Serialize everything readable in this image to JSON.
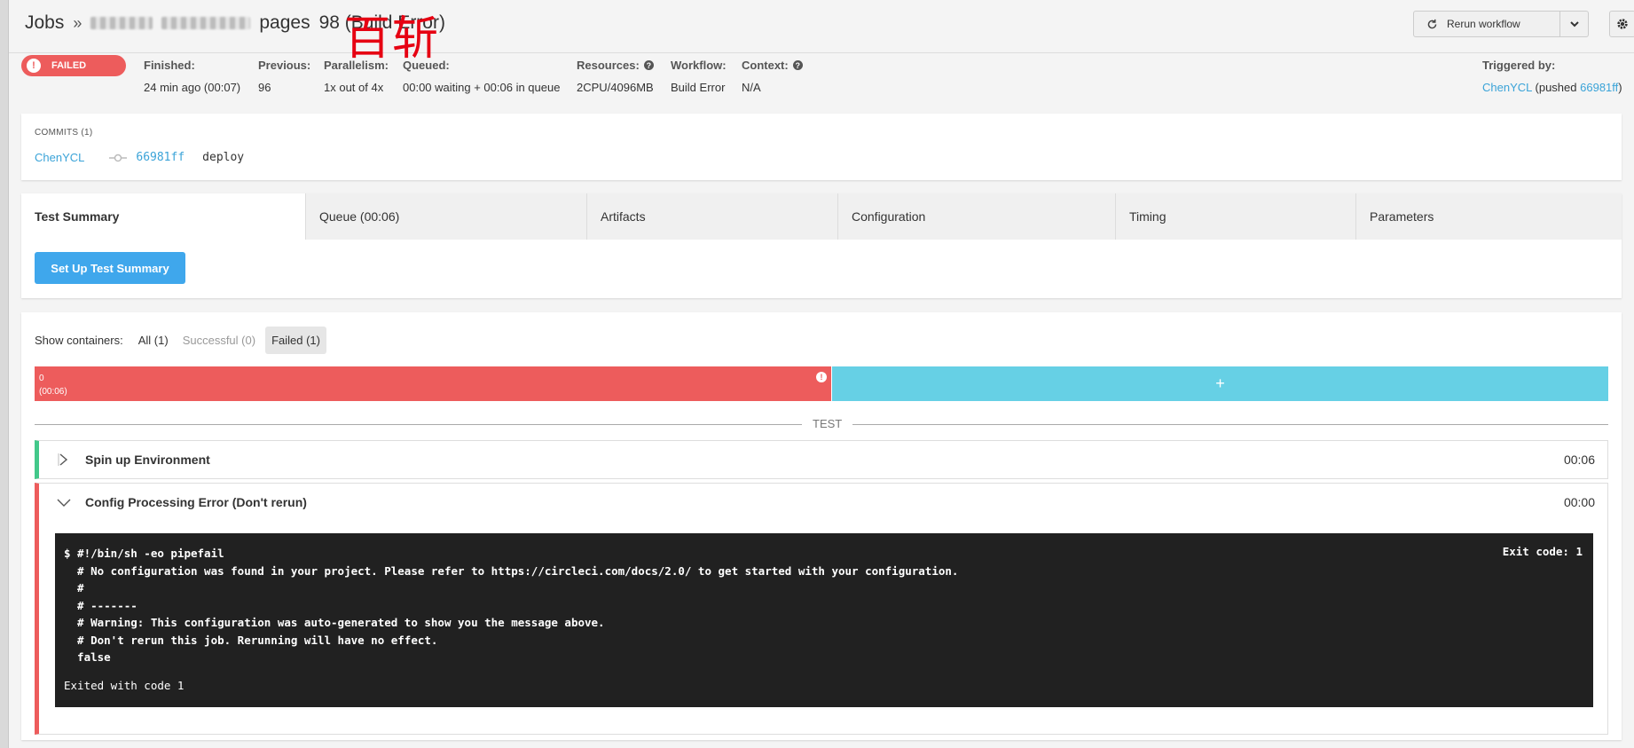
{
  "header": {
    "jobs_label": "Jobs",
    "separator": "»",
    "project_segment": "pages",
    "job_title": "98 (Build Error)",
    "watermark": "百斩",
    "rerun_label": "Rerun workflow"
  },
  "status": {
    "label": "FAILED",
    "color": "#ed5c5c"
  },
  "meta": [
    {
      "key": "Finished:",
      "value": "24 min ago (00:07)",
      "link": false,
      "help": false
    },
    {
      "key": "Previous:",
      "value": "96",
      "link": true,
      "help": false
    },
    {
      "key": "Parallelism:",
      "value": "1x out of 4x",
      "link": true,
      "help": false
    },
    {
      "key": "Queued:",
      "value": "00:00 waiting + 00:06 in queue",
      "link": false,
      "help": false
    },
    {
      "key": "Resources:",
      "value": "2CPU/4096MB",
      "link": false,
      "help": true
    },
    {
      "key": "Workflow:",
      "value": "Build Error",
      "link": true,
      "help": false
    },
    {
      "key": "Context:",
      "value": "N/A",
      "link": true,
      "help": true
    }
  ],
  "triggered": {
    "label": "Triggered by:",
    "user": "ChenYCL",
    "pushed_prefix": "(pushed",
    "commit": "66981ff",
    "suffix": ")"
  },
  "commits": {
    "title": "COMMITS (1)",
    "author": "ChenYCL",
    "hash": "66981ff",
    "message": "deploy"
  },
  "tabs": [
    {
      "label": "Test Summary",
      "active": true
    },
    {
      "label": "Queue (00:06)",
      "active": false
    },
    {
      "label": "Artifacts",
      "active": false
    },
    {
      "label": "Configuration",
      "active": false
    },
    {
      "label": "Timing",
      "active": false
    },
    {
      "label": "Parameters",
      "active": false
    }
  ],
  "setup_button": "Set Up Test Summary",
  "containers": {
    "label": "Show containers:",
    "filters": [
      {
        "label": "All (1)",
        "state": "normal"
      },
      {
        "label": "Successful (0)",
        "state": "dim"
      },
      {
        "label": "Failed (1)",
        "state": "selected"
      }
    ],
    "failed_index": "0",
    "failed_time": "(00:06)",
    "add_symbol": "+",
    "colors": {
      "failed": "#ed5c5c",
      "add": "#66d0e5"
    }
  },
  "section_label": "TEST",
  "steps": [
    {
      "name": "Spin up Environment",
      "time": "00:06",
      "status_color": "#42c88a"
    },
    {
      "name": "Config Processing Error (Don't rerun)",
      "time": "00:00",
      "status_color": "#ed5c5c"
    }
  ],
  "terminal": {
    "command": "$ #!/bin/sh -eo pipefail",
    "exit_code": "Exit code: 1",
    "lines": [
      "  # No configuration was found in your project. Please refer to https://circleci.com/docs/2.0/ to get started with your configuration.",
      "  #",
      "  # -------",
      "  # Warning: This configuration was auto-generated to show you the message above.",
      "  # Don't rerun this job. Rerunning will have no effect.",
      "  false"
    ],
    "exited": "Exited with code 1"
  }
}
